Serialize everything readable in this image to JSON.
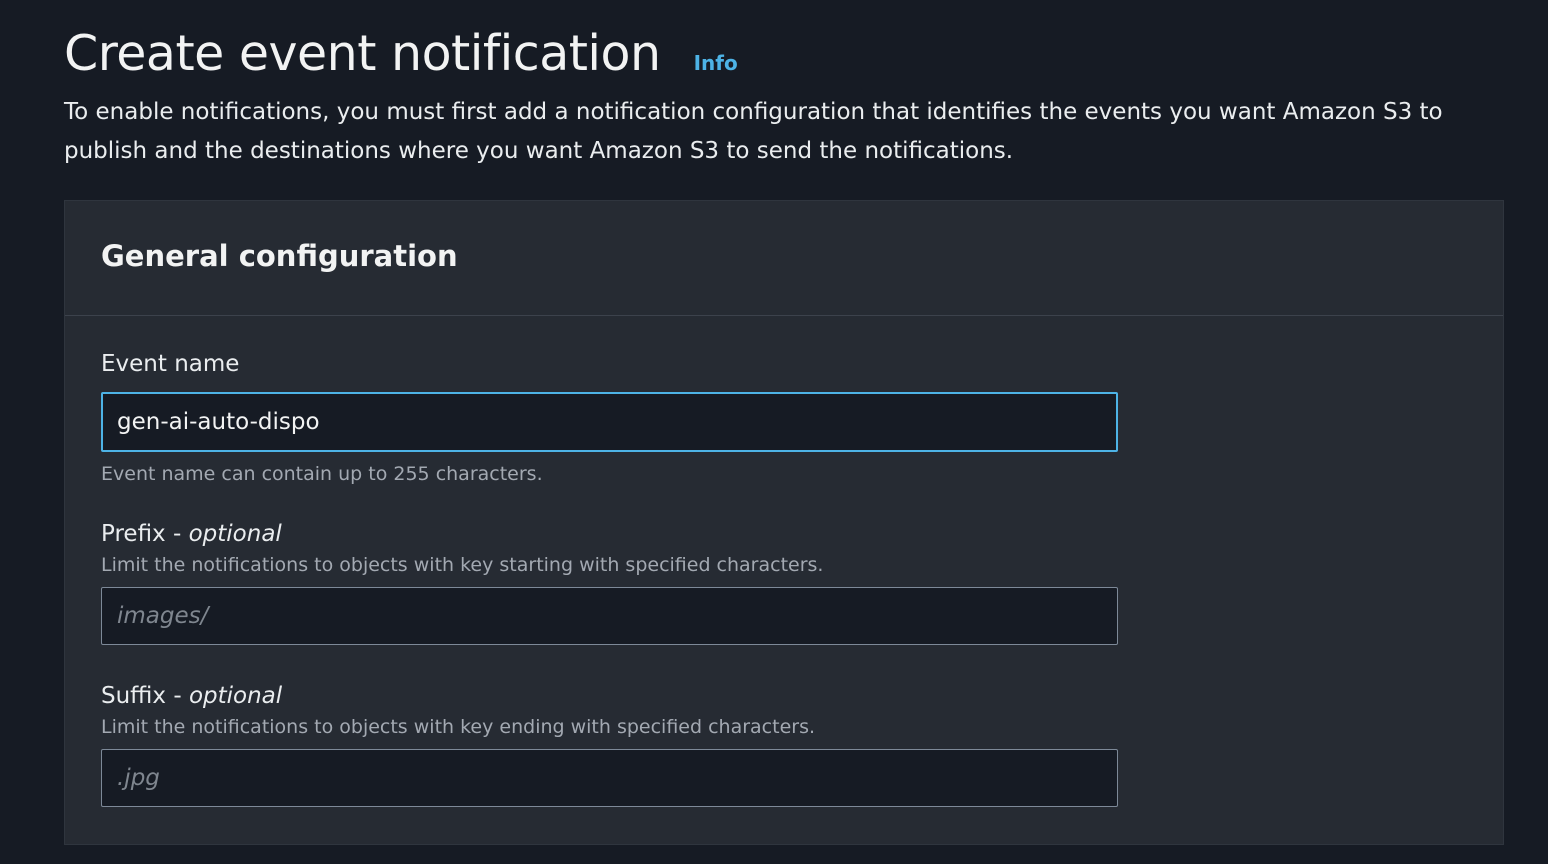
{
  "header": {
    "title": "Create event notification",
    "info_link": "Info",
    "description": "To enable notifications, you must first add a notification configuration that identifies the events you want Amazon S3 to publish and the destinations where you want Amazon S3 to send the notifications."
  },
  "general_configuration": {
    "title": "General configuration",
    "event_name": {
      "label": "Event name",
      "value": "gen-ai-auto-dispo",
      "constraint": "Event name can contain up to 255 characters."
    },
    "prefix": {
      "label": "Prefix",
      "optional": "optional",
      "description": "Limit the notifications to objects with key starting with specified characters.",
      "placeholder": "images/",
      "value": ""
    },
    "suffix": {
      "label": "Suffix",
      "optional": "optional",
      "description": "Limit the notifications to objects with key ending with specified characters.",
      "placeholder": ".jpg",
      "value": ""
    }
  },
  "colors": {
    "background": "#161b24",
    "panel": "#262b33",
    "link": "#4db3e6",
    "focus_border": "#4db3e6"
  }
}
